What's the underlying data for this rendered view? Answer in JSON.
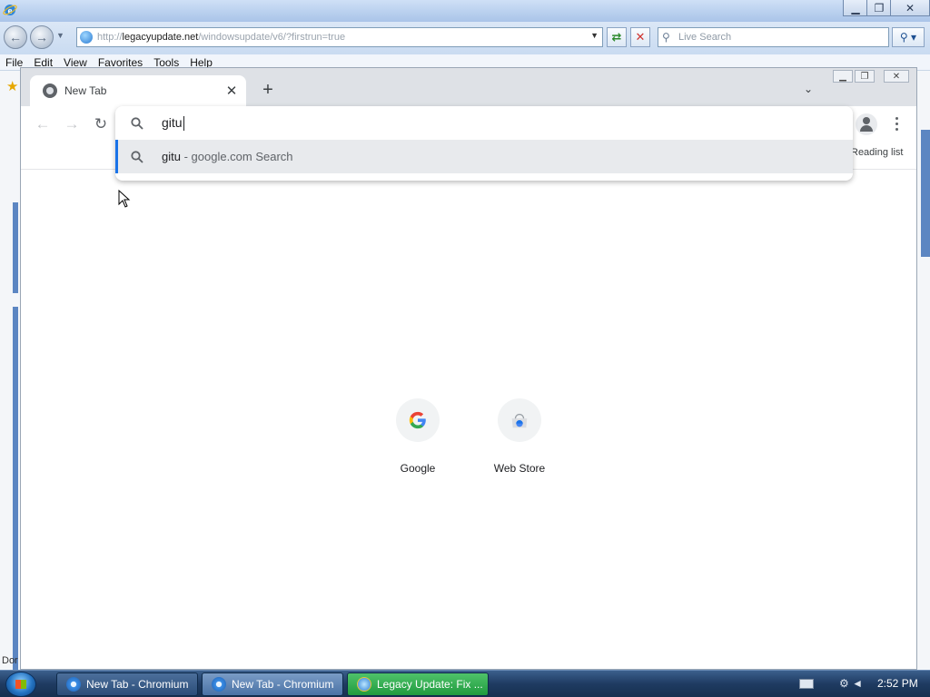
{
  "ie": {
    "address_prefix": "http://",
    "address_host": "legacyupdate.net",
    "address_path": "/windowsupdate/v6/?firstrun=true",
    "search_placeholder": "Live Search",
    "menu": [
      "File",
      "Edit",
      "View",
      "Favorites",
      "Tools",
      "Help"
    ],
    "status_text": "Dor"
  },
  "chromium": {
    "tab_title": "New Tab",
    "omnibox": {
      "query": "gitu",
      "suggestion_query": "gitu",
      "suggestion_separator": " - ",
      "suggestion_rest": "google.com Search"
    },
    "reading_list_label": "Reading list",
    "shortcuts": [
      {
        "label": "Google",
        "icon": "google-icon"
      },
      {
        "label": "Web Store",
        "icon": "web-store-icon"
      }
    ]
  },
  "taskbar": {
    "tasks": [
      {
        "label": "New Tab - Chromium",
        "icon": "chromium-icon"
      },
      {
        "label": "New Tab - Chromium",
        "icon": "chromium-icon"
      },
      {
        "label": "Legacy Update: Fix ...",
        "icon": "internet-explorer-icon"
      }
    ],
    "clock": "2:52 PM"
  }
}
